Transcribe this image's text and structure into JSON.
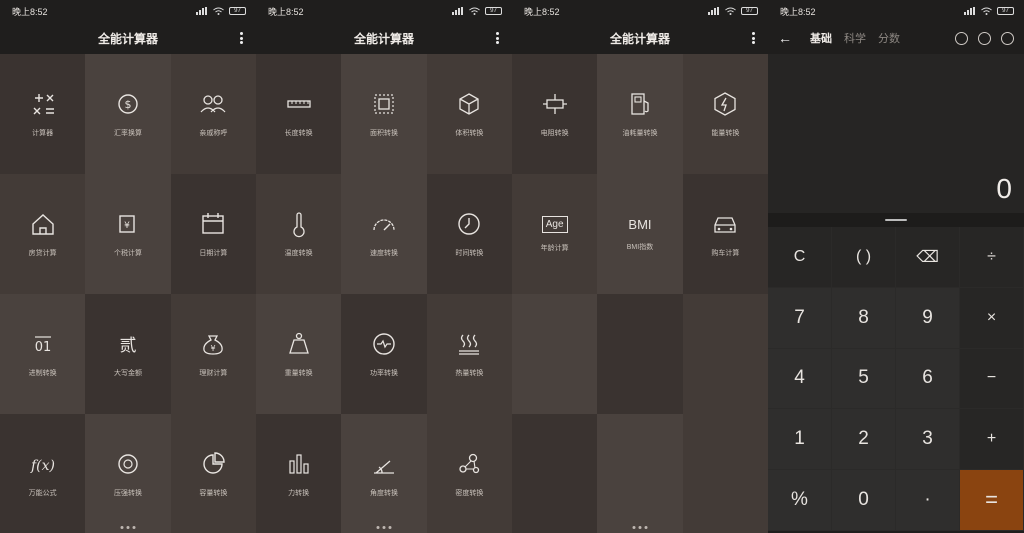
{
  "status": {
    "time": "晚上8:52",
    "battery": "97"
  },
  "app_title": "全能计算器",
  "screens": [
    {
      "tiles": [
        {
          "label": "计算器",
          "icon": "calculator-icon",
          "shade": "c0"
        },
        {
          "label": "汇率换算",
          "icon": "currency-exchange-icon",
          "shade": "c1"
        },
        {
          "label": "亲戚称呼",
          "icon": "relatives-icon",
          "shade": "c2"
        },
        {
          "label": "房贷计算",
          "icon": "house-icon",
          "shade": "c2"
        },
        {
          "label": "个税计算",
          "icon": "tax-icon",
          "shade": "c1"
        },
        {
          "label": "日期计算",
          "icon": "calendar-icon",
          "shade": "c0"
        },
        {
          "label": "进制转换",
          "icon": "binary-icon",
          "shade": "c1"
        },
        {
          "label": "大写金额",
          "icon": "uppercase-amount-icon",
          "shade": "c0"
        },
        {
          "label": "理财计算",
          "icon": "money-bag-icon",
          "shade": "c2"
        },
        {
          "label": "万能公式",
          "icon": "formula-icon",
          "shade": "c0"
        },
        {
          "label": "压强转换",
          "icon": "pressure-icon",
          "shade": "c1"
        },
        {
          "label": "容量转换",
          "icon": "pie-icon",
          "shade": "c2"
        }
      ]
    },
    {
      "tiles": [
        {
          "label": "长度转换",
          "icon": "ruler-icon",
          "shade": "c0"
        },
        {
          "label": "面积转换",
          "icon": "area-icon",
          "shade": "c1"
        },
        {
          "label": "体积转换",
          "icon": "cube-icon",
          "shade": "c2"
        },
        {
          "label": "温度转换",
          "icon": "thermometer-icon",
          "shade": "c2"
        },
        {
          "label": "速度转换",
          "icon": "speedometer-icon",
          "shade": "c1"
        },
        {
          "label": "时间转换",
          "icon": "clock-icon",
          "shade": "c0"
        },
        {
          "label": "重量转换",
          "icon": "weight-icon",
          "shade": "c1"
        },
        {
          "label": "功率转换",
          "icon": "power-icon",
          "shade": "c0"
        },
        {
          "label": "热量转换",
          "icon": "heat-icon",
          "shade": "c2"
        },
        {
          "label": "力转换",
          "icon": "bars-icon",
          "shade": "c0"
        },
        {
          "label": "角度转换",
          "icon": "angle-icon",
          "shade": "c1"
        },
        {
          "label": "密度转换",
          "icon": "molecule-icon",
          "shade": "c2"
        }
      ]
    },
    {
      "tiles": [
        {
          "label": "电阻转换",
          "icon": "resistor-icon",
          "shade": "c0"
        },
        {
          "label": "油耗量转换",
          "icon": "fuel-icon",
          "shade": "c1"
        },
        {
          "label": "能量转换",
          "icon": "energy-icon",
          "shade": "c2"
        },
        {
          "label": "年龄计算",
          "icon": "age-icon",
          "shade": "c2",
          "text": "Age"
        },
        {
          "label": "BMI指数",
          "icon": "bmi-icon",
          "shade": "c1",
          "text": "BMI"
        },
        {
          "label": "购车计算",
          "icon": "car-icon",
          "shade": "c0"
        },
        {
          "label": "",
          "icon": "",
          "shade": "c1"
        },
        {
          "label": "",
          "icon": "",
          "shade": "c0"
        },
        {
          "label": "",
          "icon": "",
          "shade": "c2"
        },
        {
          "label": "",
          "icon": "",
          "shade": "c0"
        },
        {
          "label": "",
          "icon": "",
          "shade": "c1"
        },
        {
          "label": "",
          "icon": "",
          "shade": "c2"
        }
      ]
    }
  ],
  "calculator": {
    "modes": [
      "基础",
      "科学",
      "分数"
    ],
    "active_mode": 0,
    "display": "0",
    "keys": [
      "C",
      "( )",
      "⌫",
      "÷",
      "7",
      "8",
      "9",
      "×",
      "4",
      "5",
      "6",
      "−",
      "1",
      "2",
      "3",
      "+",
      "%",
      "0",
      "·",
      "="
    ],
    "accent": "#8a4410"
  }
}
